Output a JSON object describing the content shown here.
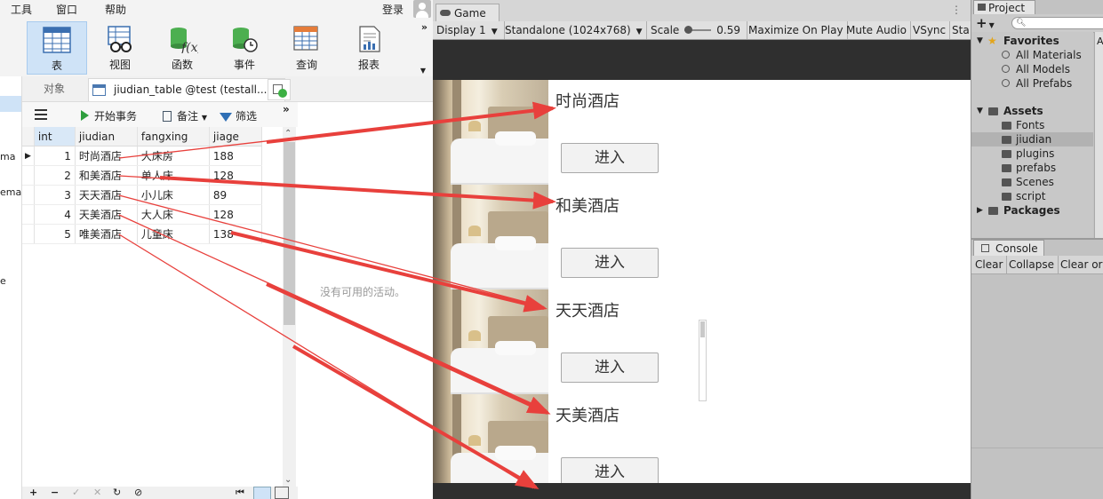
{
  "navicat": {
    "menu": [
      "工具",
      "窗口",
      "帮助"
    ],
    "login": "登录",
    "ribbon": [
      {
        "label": "表",
        "icon": "table-icon"
      },
      {
        "label": "视图",
        "icon": "view-icon"
      },
      {
        "label": "函数",
        "icon": "function-icon"
      },
      {
        "label": "事件",
        "icon": "event-icon"
      },
      {
        "label": "查询",
        "icon": "query-icon"
      },
      {
        "label": "报表",
        "icon": "report-icon"
      }
    ],
    "ribbon_more": "»",
    "left_fragments": [
      "ma",
      "ema",
      "e"
    ],
    "tabs": {
      "objects": "对象",
      "table_tab": "jiudian_table @test (testall...",
      "close": "×"
    },
    "toolbar": {
      "begin_transaction": "开始事务",
      "memo": "备注",
      "filter": "筛选",
      "more": "»"
    },
    "table": {
      "columns": [
        "int",
        "jiudian",
        "fangxing",
        "jiage"
      ],
      "rows": [
        {
          "id": "1",
          "jiudian": "时尚酒店",
          "fangxing": "大床房",
          "jiage": "188"
        },
        {
          "id": "2",
          "jiudian": "和美酒店",
          "fangxing": "单人床",
          "jiage": "128"
        },
        {
          "id": "3",
          "jiudian": "天天酒店",
          "fangxing": "小儿床",
          "jiage": "89"
        },
        {
          "id": "4",
          "jiudian": "天美酒店",
          "fangxing": "大人床",
          "jiage": "128"
        },
        {
          "id": "5",
          "jiudian": "唯美酒店",
          "fangxing": "儿童床",
          "jiage": "138"
        }
      ]
    },
    "no_activity": "没有可用的活动。"
  },
  "game": {
    "tab": "Game",
    "toolbar": {
      "display": "Display 1",
      "resolution": "Standalone (1024x768)",
      "scale_label": "Scale",
      "scale_value": "0.59",
      "maximize": "Maximize On Play",
      "mute": "Mute Audio",
      "vsync": "VSync",
      "stats": "Sta"
    },
    "hotels": [
      {
        "name": "时尚酒店",
        "button": "进入"
      },
      {
        "name": "和美酒店",
        "button": "进入"
      },
      {
        "name": "天天酒店",
        "button": "进入"
      },
      {
        "name": "天美酒店",
        "button": "进入"
      }
    ]
  },
  "project": {
    "tab": "Project",
    "search_placeholder": "",
    "favorites_label": "Favorites",
    "favorites": [
      "All Materials",
      "All Models",
      "All Prefabs"
    ],
    "assets_label": "Assets",
    "assets": [
      "Fonts",
      "jiudian",
      "plugins",
      "prefabs",
      "Scenes",
      "script"
    ],
    "packages_label": "Packages",
    "side_letter": "A"
  },
  "console": {
    "tab": "Console",
    "buttons": [
      "Clear",
      "Collapse",
      "Clear or"
    ]
  },
  "colors": {
    "arrow": "#e8403c",
    "ribbon_active": "#cfe3f7",
    "game_bg": "#2f2f2f"
  }
}
